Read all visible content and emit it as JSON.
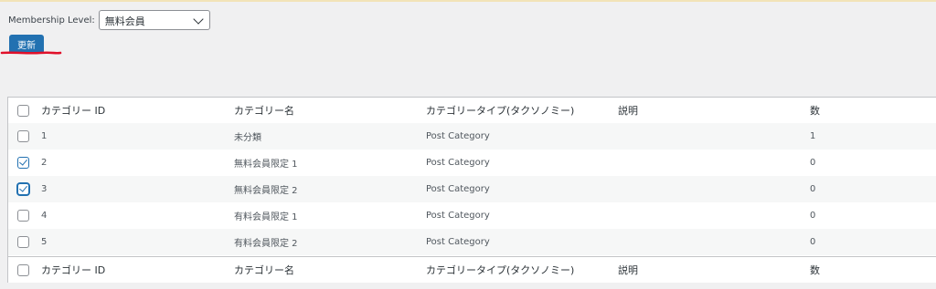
{
  "membership": {
    "label": "Membership Level:",
    "selected": "無料会員"
  },
  "update_button": "更新",
  "colors": {
    "accent": "#2271b1",
    "annotation": "#e0102a"
  },
  "table": {
    "headers": {
      "id": "カテゴリー ID",
      "name": "カテゴリー名",
      "type": "カテゴリータイプ(タクソノミー)",
      "desc": "説明",
      "count": "数"
    },
    "rows": [
      {
        "id": "1",
        "name": "未分類",
        "type": "Post Category",
        "desc": "",
        "count": "1",
        "checked": false
      },
      {
        "id": "2",
        "name": "無料会員限定 1",
        "type": "Post Category",
        "desc": "",
        "count": "0",
        "checked": true
      },
      {
        "id": "3",
        "name": "無料会員限定 2",
        "type": "Post Category",
        "desc": "",
        "count": "0",
        "checked": true
      },
      {
        "id": "4",
        "name": "有料会員限定 1",
        "type": "Post Category",
        "desc": "",
        "count": "0",
        "checked": false
      },
      {
        "id": "5",
        "name": "有料会員限定 2",
        "type": "Post Category",
        "desc": "",
        "count": "0",
        "checked": false
      }
    ]
  }
}
